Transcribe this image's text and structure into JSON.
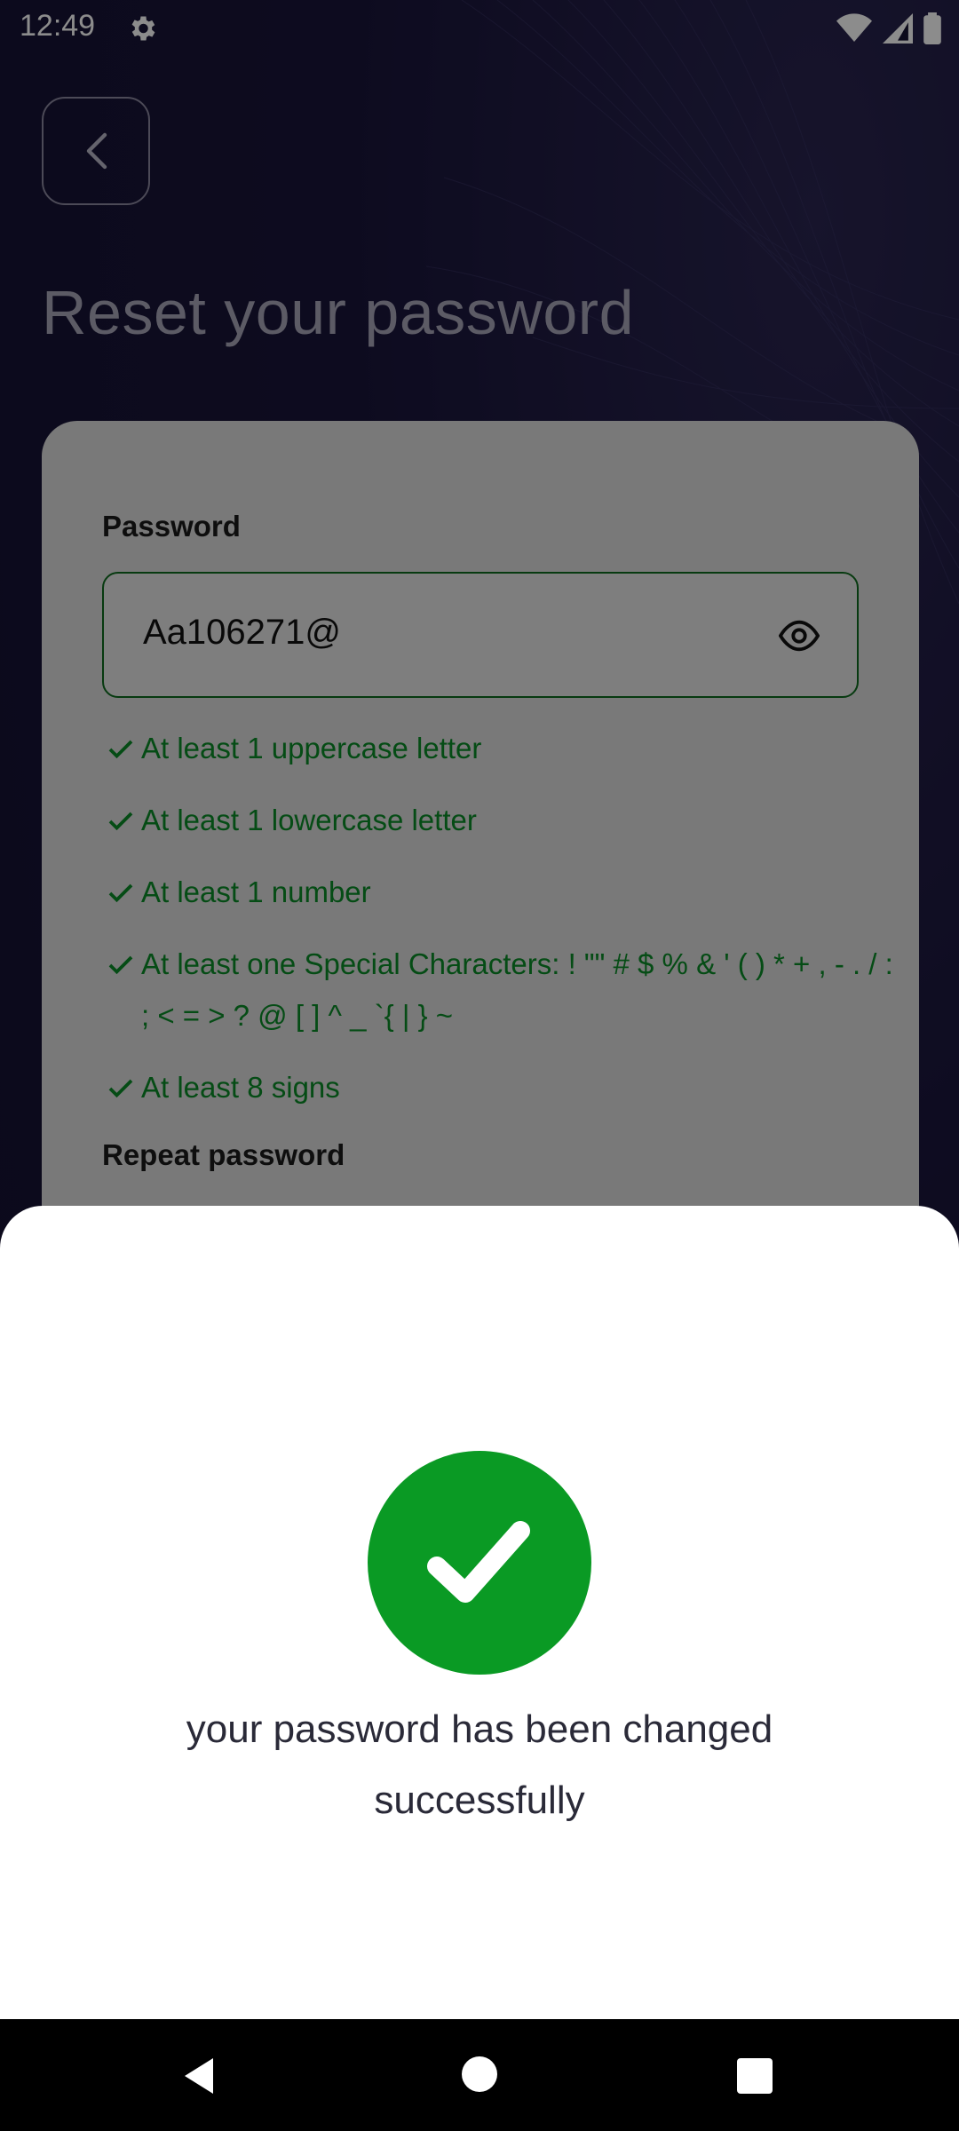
{
  "status_bar": {
    "time": "12:49"
  },
  "header": {
    "title": "Reset your password"
  },
  "form": {
    "password_label": "Password",
    "password_value": "Aa106271@",
    "repeat_label": "Repeat password",
    "rules": [
      "At least 1 uppercase letter",
      "At least 1 lowercase letter",
      "At least 1 number",
      "At least one Special Characters: ! \"\" # $ % & ' ( ) * + , - . / : ; < = > ? @ [  ] ^ _ `{ | } ~",
      "At least 8 signs"
    ]
  },
  "dialog": {
    "message_line1": "your password has been changed",
    "message_line2": "successfully"
  },
  "colors": {
    "success": "#0a9a24",
    "rule_text": "#0a8a27",
    "background": "#171330"
  }
}
